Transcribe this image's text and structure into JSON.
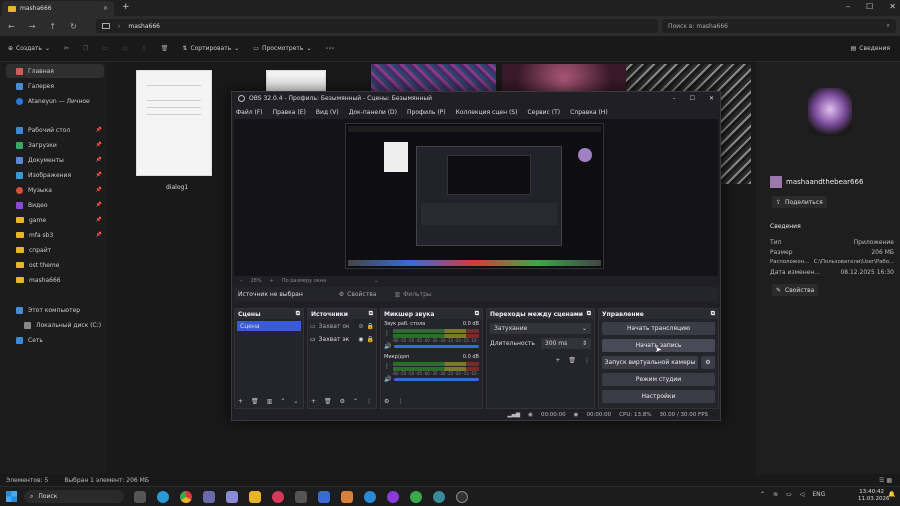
{
  "explorer": {
    "tab_title": "masha666",
    "address": "masha666",
    "search_placeholder": "Поиск в: masha666",
    "cmd": {
      "create": "Создать",
      "sort": "Сортировать",
      "view": "Просмотреть",
      "details": "Сведения"
    },
    "sidebar": {
      "home": "Главная",
      "gallery": "Галерея",
      "personal": "Ataneyun — Личное",
      "desktop": "Рабочий стол",
      "downloads": "Загрузки",
      "documents": "Документы",
      "images": "Изображения",
      "music": "Музыка",
      "video": "Видео",
      "game": "game",
      "mfa": "mfa sb3",
      "sprite": "спрайт",
      "ost": "ost theme",
      "masha": "masha666",
      "this_pc": "Этот компьютер",
      "local_disk": "Локальный диск (C:)",
      "network": "Сеть"
    },
    "file_label": "dialog1",
    "details_panel": {
      "name": "mashaandthebear666",
      "share": "Поделиться",
      "section": "Сведения",
      "rows": [
        {
          "k": "Тип",
          "v": "Приложение"
        },
        {
          "k": "Размер",
          "v": "206 МБ"
        },
        {
          "k": "Расположен...",
          "v": "C:\\Пользователи\\User\\Рабо..."
        },
        {
          "k": "Дата изменен...",
          "v": "08.12.2025 16:30"
        }
      ],
      "properties": "Свойства"
    },
    "status_count": "Элементов: 5",
    "status_selected": "Выбран 1 элемент: 206 МБ"
  },
  "taskbar": {
    "search": "Поиск",
    "lang": "ENG",
    "time": "13:40:42",
    "date": "11.03.2026"
  },
  "obs": {
    "title": "OBS 32.0.4 - Профиль: Безымянный - Сцены: Безымянный",
    "menu": [
      "Файл (F)",
      "Правка (E)",
      "Вид (V)",
      "Док-панели (D)",
      "Профиль (P)",
      "Коллекция сцен (S)",
      "Сервис (T)",
      "Справка (H)"
    ],
    "zoom": "28%",
    "zoom_mode": "По размеру окна",
    "no_source": "Источник не выбран",
    "properties": "Свойства",
    "filters": "Фильтры",
    "scenes": {
      "title": "Сцены",
      "item": "Сцена"
    },
    "sources": {
      "title": "Источники",
      "items": [
        "Захват ок",
        "Захват эк"
      ]
    },
    "mixer": {
      "title": "Микшер звука",
      "ch1": {
        "name": "Звук раб. стола",
        "db": "0.0 dB"
      },
      "ch2": {
        "name": "Микр/доп",
        "db": "0.0 dB"
      },
      "scale": "-60 -55 -50 -45 -40 -35 -30 -25 -20 -15 -10 -5 0"
    },
    "transitions": {
      "title": "Переходы между сценами",
      "type": "Затухание",
      "duration_label": "Длительность",
      "duration": "300 ms"
    },
    "controls": {
      "title": "Управление",
      "stream": "Начать трансляцию",
      "record": "Начать запись",
      "vcam": "Запуск виртуальной камеры",
      "studio": "Режим студии",
      "settings": "Настройки"
    },
    "statusbar": {
      "t1": "00:00:00",
      "t2": "00:00:00",
      "cpu": "CPU: 13.8%",
      "fps": "30.00 / 30.00 FPS"
    }
  }
}
